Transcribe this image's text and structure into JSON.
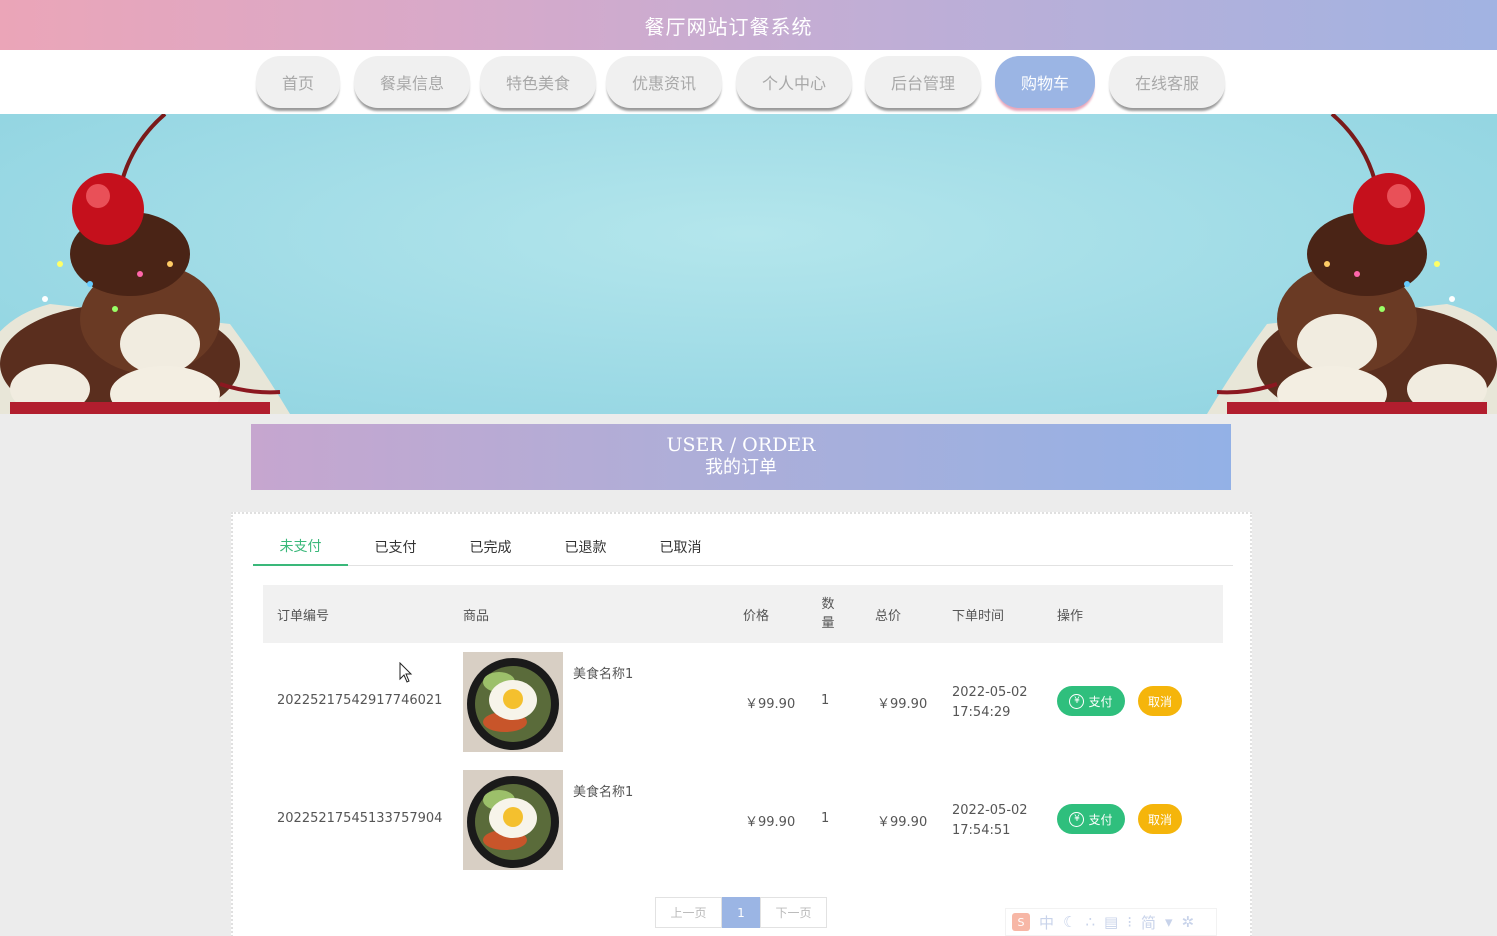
{
  "header": {
    "title": "餐厅网站订餐系统"
  },
  "nav": {
    "items": [
      {
        "label": "首页"
      },
      {
        "label": "餐桌信息"
      },
      {
        "label": "特色美食"
      },
      {
        "label": "优惠资讯"
      },
      {
        "label": "个人中心"
      },
      {
        "label": "后台管理"
      },
      {
        "label": "购物车"
      },
      {
        "label": "在线客服"
      }
    ],
    "active_label": "购物车"
  },
  "section": {
    "title_en": "USER / ORDER",
    "title_cn": "我的订单"
  },
  "tabs": [
    {
      "label": "未支付"
    },
    {
      "label": "已支付"
    },
    {
      "label": "已完成"
    },
    {
      "label": "已退款"
    },
    {
      "label": "已取消"
    }
  ],
  "active_tab": "未支付",
  "table": {
    "headers": {
      "order_no": "订单编号",
      "product": "商品",
      "price": "价格",
      "qty_line1": "数",
      "qty_line2": "量",
      "total": "总价",
      "time": "下单时间",
      "action": "操作"
    },
    "rows": [
      {
        "order_no": "20225217542917746021",
        "product_name": "美食名称1",
        "price": "￥99.90",
        "qty": "1",
        "total": "￥99.90",
        "date": "2022-05-02",
        "time": "17:54:29",
        "pay_label": "支付",
        "cancel_label": "取消"
      },
      {
        "order_no": "20225217545133757904",
        "product_name": "美食名称1",
        "price": "￥99.90",
        "qty": "1",
        "total": "￥99.90",
        "date": "2022-05-02",
        "time": "17:54:51",
        "pay_label": "支付",
        "cancel_label": "取消"
      }
    ]
  },
  "pagination": {
    "prev": "上一页",
    "current": "1",
    "next": "下一页"
  },
  "ime_toolbar": {
    "mode": "中",
    "simplified": "简"
  },
  "colors": {
    "accent_green": "#2fbf7d",
    "accent_yellow": "#f5b50b",
    "nav_active": "#9bb5e4",
    "tab_active": "#3ab87a"
  }
}
